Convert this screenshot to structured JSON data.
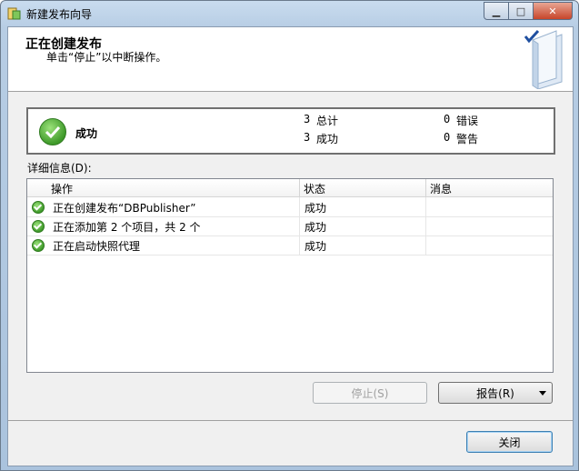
{
  "window": {
    "title": "新建发布向导"
  },
  "header": {
    "title": "正在创建发布",
    "subtitle": "单击“停止”以中断操作。"
  },
  "status": {
    "label": "成功",
    "total_count": "3",
    "total_label": "总计",
    "success_count": "3",
    "success_label": "成功",
    "error_count": "0",
    "error_label": "错误",
    "warning_count": "0",
    "warning_label": "警告"
  },
  "details": {
    "label": "详细信息(D):",
    "columns": [
      "操作",
      "状态",
      "消息"
    ],
    "rows": [
      {
        "action": "正在创建发布“DBPublisher”",
        "status": "成功",
        "message": ""
      },
      {
        "action": "正在添加第 2 个项目，共 2 个",
        "status": "成功",
        "message": ""
      },
      {
        "action": "正在启动快照代理",
        "status": "成功",
        "message": ""
      }
    ]
  },
  "buttons": {
    "stop": "停止(S)",
    "report": "报告(R)",
    "close": "关闭"
  },
  "colors": {
    "success_green": "#3f9a2a",
    "window_frame": "#b7cde4",
    "close_button": "#c7452a"
  },
  "icons": {
    "app": "wizard-icon",
    "status": "success-check-icon",
    "banner": "book-check-icon"
  }
}
